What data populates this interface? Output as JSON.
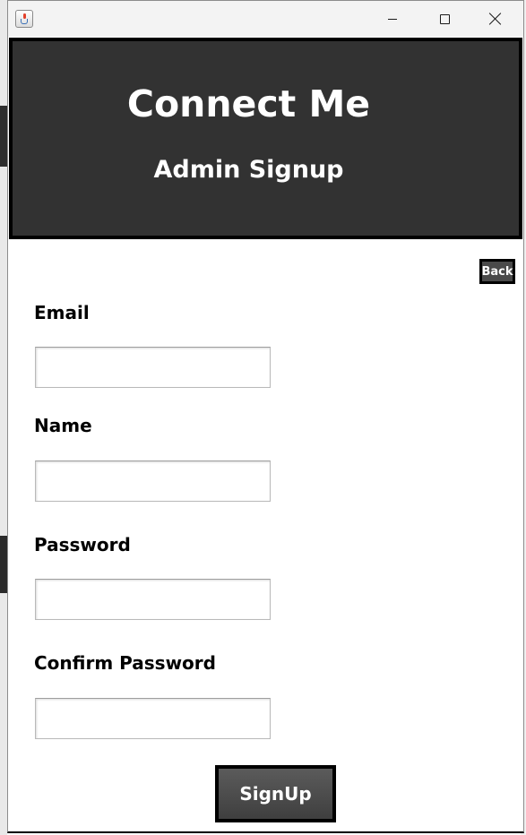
{
  "window": {
    "title": "",
    "controls": {
      "minimize_icon": "minimize-icon",
      "maximize_icon": "maximize-icon",
      "close_icon": "close-icon"
    }
  },
  "header": {
    "title": "Connect Me",
    "subtitle": "Admin Signup",
    "background": "#323232"
  },
  "back_button": {
    "label": "Back"
  },
  "form": {
    "email": {
      "label": "Email",
      "value": "",
      "placeholder": ""
    },
    "name": {
      "label": "Name",
      "value": "",
      "placeholder": ""
    },
    "password": {
      "label": "Password",
      "value": "",
      "placeholder": ""
    },
    "confirm_password": {
      "label": "Confirm Password",
      "value": "",
      "placeholder": ""
    }
  },
  "signup_button": {
    "label": "SignUp"
  },
  "colors": {
    "accent_dark": "#323232",
    "button_dark": "#4a4a4a",
    "text_on_dark": "#ffffff"
  }
}
